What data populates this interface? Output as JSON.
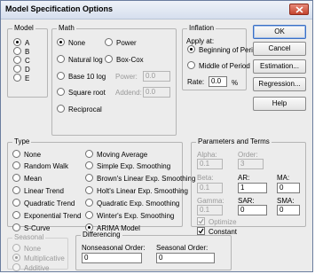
{
  "window": {
    "title": "Model Specification Options"
  },
  "model": {
    "label": "Model",
    "options": [
      "A",
      "B",
      "C",
      "D",
      "E"
    ],
    "selected": "A"
  },
  "math": {
    "label": "Math",
    "none": "None",
    "natural_log": "Natural log",
    "base10": "Base 10 log",
    "square_root": "Square root",
    "reciprocal": "Reciprocal",
    "power": "Power",
    "box_cox": "Box-Cox",
    "power_label": "Power:",
    "power_value": "0.0",
    "addend_label": "Addend:",
    "addend_value": "0.0"
  },
  "inflation": {
    "label": "Inflation",
    "apply_at": "Apply at:",
    "beginning": "Beginning of Period",
    "middle": "Middle of Period",
    "rate_label": "Rate:",
    "rate_value": "0.0",
    "rate_unit": "%"
  },
  "buttons": {
    "ok": "OK",
    "cancel": "Cancel",
    "estimation": "Estimation...",
    "regression": "Regression...",
    "help": "Help"
  },
  "type": {
    "label": "Type",
    "options_left": [
      "None",
      "Random Walk",
      "Mean",
      "Linear Trend",
      "Quadratic Trend",
      "Exponential Trend",
      "S-Curve"
    ],
    "options_right": [
      "Moving Average",
      "Simple Exp. Smoothing",
      "Brown's Linear Exp. Smoothing",
      "Holt's Linear Exp. Smoothing",
      "Quadratic Exp. Smoothing",
      "Winter's Exp. Smoothing",
      "ARIMA Model"
    ],
    "selected": "ARIMA Model"
  },
  "params": {
    "label": "Parameters and Terms",
    "alpha_label": "Alpha:",
    "alpha_value": "0.1",
    "order_label": "Order:",
    "order_value": "3",
    "beta_label": "Beta:",
    "beta_value": "0.1",
    "ar_label": "AR:",
    "ar_value": "1",
    "ma_label": "MA:",
    "ma_value": "0",
    "gamma_label": "Gamma:",
    "gamma_value": "0.1",
    "sar_label": "SAR:",
    "sar_value": "0",
    "sma_label": "SMA:",
    "sma_value": "0",
    "optimize_label": "Optimize",
    "constant_label": "Constant"
  },
  "seasonal": {
    "label": "Seasonal",
    "none": "None",
    "multiplicative": "Multiplicative",
    "additive": "Additive"
  },
  "differencing": {
    "label": "Differencing",
    "nonseasonal_label": "Nonseasonal Order:",
    "nonseasonal_value": "0",
    "seasonal_label": "Seasonal Order:",
    "seasonal_value": "0"
  }
}
